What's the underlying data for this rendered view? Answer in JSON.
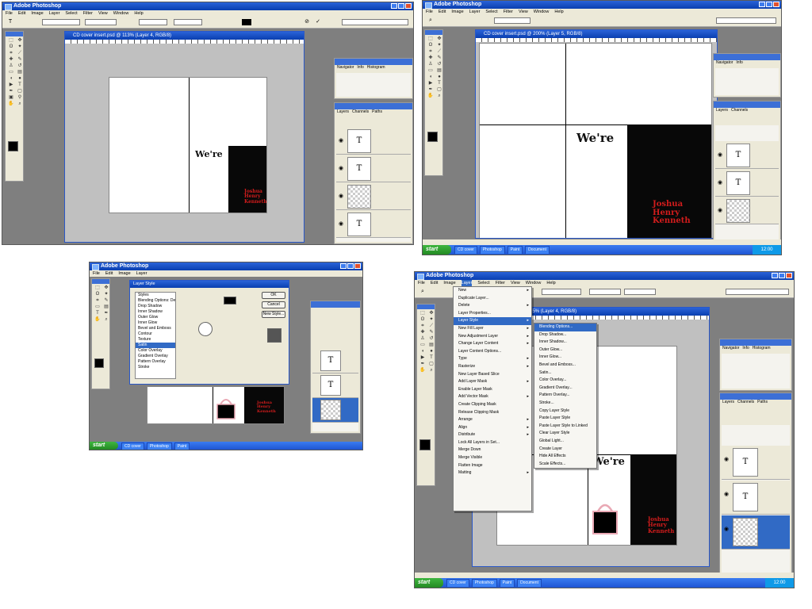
{
  "app_title": "Adobe Photoshop",
  "menus": [
    "File",
    "Edit",
    "Image",
    "Layer",
    "Select",
    "Filter",
    "View",
    "Window",
    "Help"
  ],
  "doc_title_1": "CD cover insert.psd @ 113% (Layer 4, RGB/8)",
  "doc_title_2": "CD cover insert.psd @ 200% (Layer 5, RGB/8)",
  "doc_title_4": "CD cover insert.psd @ 75% (Layer 4, RGB/8)",
  "canvas_text": "We're",
  "red_text": "Joshua\nHenry\nKenneth",
  "layer_glyph": "T",
  "start_label": "start",
  "taskbar_items": [
    "CD cover",
    "Photoshop",
    "Paint",
    "Document"
  ],
  "tray_time": "12:00",
  "layer_menu": {
    "items": [
      "New",
      "Duplicate Layer...",
      "Delete",
      "Layer Properties...",
      "Layer Style",
      "New Fill Layer",
      "New Adjustment Layer",
      "Change Layer Content",
      "Layer Content Options...",
      "Type",
      "Rasterize",
      "New Layer Based Slice",
      "Add Layer Mask",
      "Enable Layer Mask",
      "Add Vector Mask",
      "Create Clipping Mask",
      "Release Clipping Mask",
      "Arrange",
      "Align",
      "Distribute",
      "Lock All Layers in Set...",
      "Merge Down",
      "Merge Visible",
      "Flatten Image",
      "Matting"
    ]
  },
  "style_submenu": {
    "items": [
      "Blending Options...",
      "Drop Shadow...",
      "Inner Shadow...",
      "Outer Glow...",
      "Inner Glow...",
      "Bevel and Emboss...",
      "Satin...",
      "Color Overlay...",
      "Gradient Overlay...",
      "Pattern Overlay...",
      "Stroke...",
      "Copy Layer Style",
      "Paste Layer Style",
      "Paste Layer Style to Linked",
      "Clear Layer Style",
      "Global Light...",
      "Create Layer",
      "Hide All Effects",
      "Scale Effects..."
    ]
  },
  "dialog": {
    "title": "Layer Style",
    "styles": [
      "Styles",
      "Blending Options: Default",
      "Drop Shadow",
      "Inner Shadow",
      "Outer Glow",
      "Inner Glow",
      "Bevel and Emboss",
      "Contour",
      "Texture",
      "Satin",
      "Color Overlay",
      "Gradient Overlay",
      "Pattern Overlay",
      "Stroke"
    ],
    "buttons": [
      "OK",
      "Cancel",
      "New Style...",
      "Preview"
    ]
  },
  "panel_tabs": [
    "Navigator",
    "Info",
    "Histogram"
  ],
  "layers_tabs": [
    "Layers",
    "Channels",
    "Paths"
  ],
  "colors": {
    "xp_blue": "#0a3fb0",
    "canvas_black": "#080808",
    "text_red": "#d21c1c",
    "bag_pink": "#e9a8b4"
  }
}
